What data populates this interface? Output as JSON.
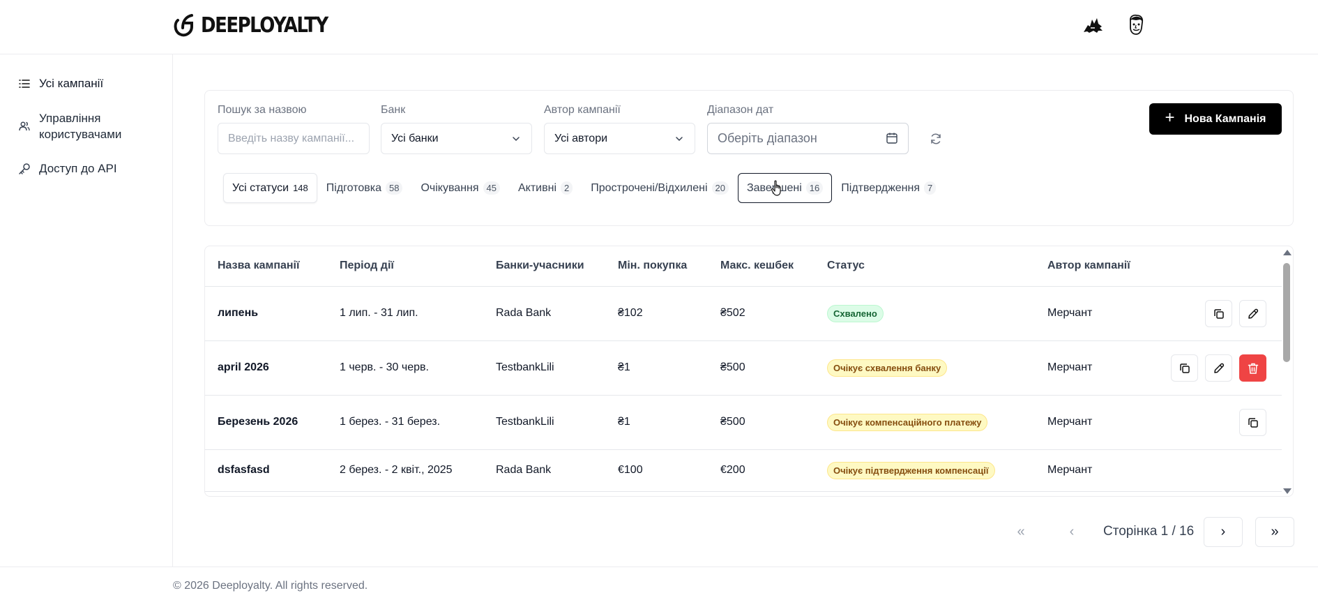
{
  "header": {
    "brand": "DEEPLOYALTY",
    "icons": [
      "bank-logo-icon",
      "user-avatar-icon"
    ]
  },
  "sidebar": {
    "items": [
      {
        "label": "Усі кампанії",
        "icon": "list-icon"
      },
      {
        "label": "Управління користувачами",
        "icon": "users-icon"
      },
      {
        "label": "Доступ до API",
        "icon": "key-icon"
      }
    ]
  },
  "filters": {
    "search": {
      "label": "Пошук за назвою",
      "placeholder": "Введіть назву кампанії..."
    },
    "bank": {
      "label": "Банк",
      "value": "Усі банки"
    },
    "author": {
      "label": "Автор кампанії",
      "value": "Усі автори"
    },
    "dates": {
      "label": "Діапазон дат",
      "placeholder": "Оберіть діапазон"
    },
    "new_button": "Нова Кампанія"
  },
  "tabs": [
    {
      "label": "Усі статуси",
      "count": "148"
    },
    {
      "label": "Підготовка",
      "count": "58"
    },
    {
      "label": "Очікування",
      "count": "45"
    },
    {
      "label": "Активні",
      "count": "2"
    },
    {
      "label": "Прострочені/Відхилені",
      "count": "20"
    },
    {
      "label": "Завершені",
      "count": "16"
    },
    {
      "label": "Підтвердження",
      "count": "7"
    }
  ],
  "table": {
    "columns": [
      "Назва кампанії",
      "Період дії",
      "Банки-учасники",
      "Мін. покупка",
      "Макс. кешбек",
      "Статус",
      "Автор кампанії"
    ],
    "rows": [
      {
        "name": "липень",
        "period": "1 лип. - 31 лип.",
        "banks": "Rada Bank",
        "min": "₴102",
        "max": "₴502",
        "status": "Схвалено",
        "status_color": "#dcfce7",
        "author": "Мерчант",
        "actions": [
          "copy-icon",
          "edit-icon"
        ]
      },
      {
        "name": "april 2026",
        "period": "1 черв. - 30 черв.",
        "banks": "TestbankLili",
        "min": "₴1",
        "max": "₴500",
        "status": "Очікує схвалення банку",
        "status_color": "#fef9c3",
        "author": "Мерчант",
        "actions": [
          "copy-icon",
          "edit-icon",
          "trash-icon"
        ]
      },
      {
        "name": "Березень 2026",
        "period": "1 берез. - 31 берез.",
        "banks": "TestbankLili",
        "min": "₴1",
        "max": "₴500",
        "status": "Очікує компенсаційного платежу",
        "status_color": "#fef9c3",
        "author": "Мерчант",
        "actions": [
          "copy-icon"
        ]
      },
      {
        "name": "dsfasfasd",
        "period": "2 берез. - 2 квіт., 2025",
        "banks": "Rada Bank",
        "min": "€100",
        "max": "€200",
        "status": "Очікує підтвердження компенсації",
        "status_color": "#fef9c3",
        "author": "Мерчант",
        "actions": []
      }
    ]
  },
  "pagination": {
    "first": "«",
    "prev": "‹",
    "info": "Сторінка 1 / 16",
    "next": "›",
    "last": "»"
  },
  "footer": {
    "text": "© 2026 Deeployalty. All rights reserved."
  }
}
